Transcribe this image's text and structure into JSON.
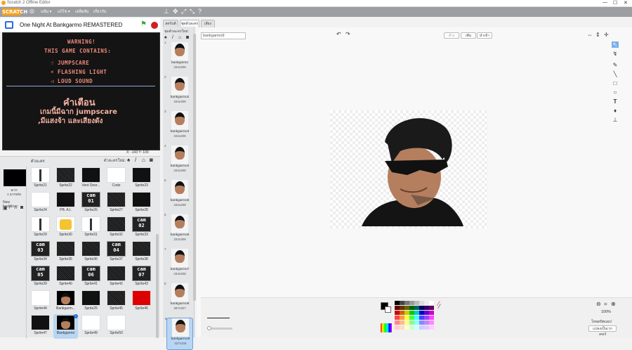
{
  "window": {
    "title": "Scratch 2 Offline Editor"
  },
  "menubar": {
    "logo": "SCRATCH",
    "file": "แฟ้ม ▾",
    "edit": "แก้ไข ▾",
    "tips": "เคล็ดลับ",
    "about": "เกี่ยวกับ"
  },
  "stage": {
    "project_title": "One Night At Bankgarmo REMASTERED",
    "warning_title": "WARNING!",
    "warning_sub": "THIS GAME CONTAINS:",
    "items": [
      "JUMPSCARE",
      "FLASHING LIGHT",
      "LOUD SOUND"
    ],
    "thai_title": "คำเตือน",
    "thai_line1": "เกมนี้มีฉาก jumpscare",
    "thai_line2": ",มีแสงจ้า และเสียงดัง",
    "coords": "X: -143  Y: 100"
  },
  "sprites": {
    "header": "ตัวละคร",
    "new_sprite": "ตัวละครใหม่:",
    "stage_label": "ฉาก",
    "stage_sub": "1 ฉากหลัง",
    "new_backdrop": "New backdrop:",
    "items": [
      {
        "name": "Sprite21",
        "kind": "line"
      },
      {
        "name": "Sprite22",
        "kind": "noise"
      },
      {
        "name": "Vent Door...",
        "kind": "dark"
      },
      {
        "name": "Code",
        "kind": "blank"
      },
      {
        "name": "Sprite23",
        "kind": "dark"
      },
      {
        "name": "Sprite24",
        "kind": "blank"
      },
      {
        "name": "PB. A.I.",
        "kind": "dark"
      },
      {
        "name": "Sprite26",
        "kind": "cam",
        "text": "cam 01"
      },
      {
        "name": "Sprite27",
        "kind": "noise"
      },
      {
        "name": "Sprite28",
        "kind": "dark"
      },
      {
        "name": "Sprite29",
        "kind": "line"
      },
      {
        "name": "Sprite30",
        "kind": "yellow"
      },
      {
        "name": "Sprite31",
        "kind": "line"
      },
      {
        "name": "Sprite32",
        "kind": "noise"
      },
      {
        "name": "Sprite33",
        "kind": "cam",
        "text": "cam 02"
      },
      {
        "name": "Sprite34",
        "kind": "cam",
        "text": "cam 03"
      },
      {
        "name": "Sprite35",
        "kind": "noise"
      },
      {
        "name": "Sprite36",
        "kind": "noise"
      },
      {
        "name": "Sprite37",
        "kind": "cam",
        "text": "cam 04"
      },
      {
        "name": "Sprite38",
        "kind": "noise"
      },
      {
        "name": "Sprite39",
        "kind": "cam",
        "text": "cam 05"
      },
      {
        "name": "Sprite40",
        "kind": "noise"
      },
      {
        "name": "Sprite41",
        "kind": "cam",
        "text": "cam 06"
      },
      {
        "name": "Sprite42",
        "kind": "noise"
      },
      {
        "name": "Sprite43",
        "kind": "cam",
        "text": "cam 07"
      },
      {
        "name": "Sprite44",
        "kind": "blank"
      },
      {
        "name": "Bankgarm...",
        "kind": "face"
      },
      {
        "name": "Sprite25",
        "kind": "dark"
      },
      {
        "name": "Sprite45",
        "kind": "noise"
      },
      {
        "name": "Sprite46",
        "kind": "red"
      },
      {
        "name": "Sprite47",
        "kind": "dark"
      },
      {
        "name": "Bankgarmo",
        "kind": "face",
        "selected": true
      },
      {
        "name": "Sprite49",
        "kind": "blank"
      },
      {
        "name": "Sprite50",
        "kind": "blank"
      }
    ]
  },
  "tabs": {
    "scripts": "สคริปต์",
    "costumes": "ชุดตัวละคร",
    "sounds": "เสียง"
  },
  "costumes": {
    "new_label": "ชุดตัวละครใหม่:",
    "items": [
      {
        "num": "1",
        "name": "bankgarmo",
        "dims": "334x308"
      },
      {
        "num": "2",
        "name": "bankgarmo2",
        "dims": "334x308"
      },
      {
        "num": "3",
        "name": "bankgarmo3",
        "dims": "334x308"
      },
      {
        "num": "4",
        "name": "bankgarmo4",
        "dims": "334x308"
      },
      {
        "num": "5",
        "name": "bankgarmo5",
        "dims": "334x308"
      },
      {
        "num": "6",
        "name": "bankgarmo6",
        "dims": "334x308"
      },
      {
        "num": "7",
        "name": "bankgarmo7",
        "dims": "334x308"
      },
      {
        "num": "8",
        "name": "bankgarmo8",
        "dims": "387x307"
      },
      {
        "num": "9",
        "name": "bankgarmo9",
        "dims": "427x334",
        "selected": true
      }
    ]
  },
  "editor": {
    "costume_name": "bankgarmo9",
    "clear": "ล้าง",
    "add": "เพิ่ม",
    "import": "นำเข้า",
    "zoom": "100%",
    "mode_label": "โหมดบิตแมป",
    "convert_button": "แปลงเป็นเวกเตอร์"
  },
  "colors": {
    "accent": "#f7a21b",
    "stop": "#cc2222",
    "flag": "#3daa3d",
    "warning_text": "#ee8a7d"
  }
}
